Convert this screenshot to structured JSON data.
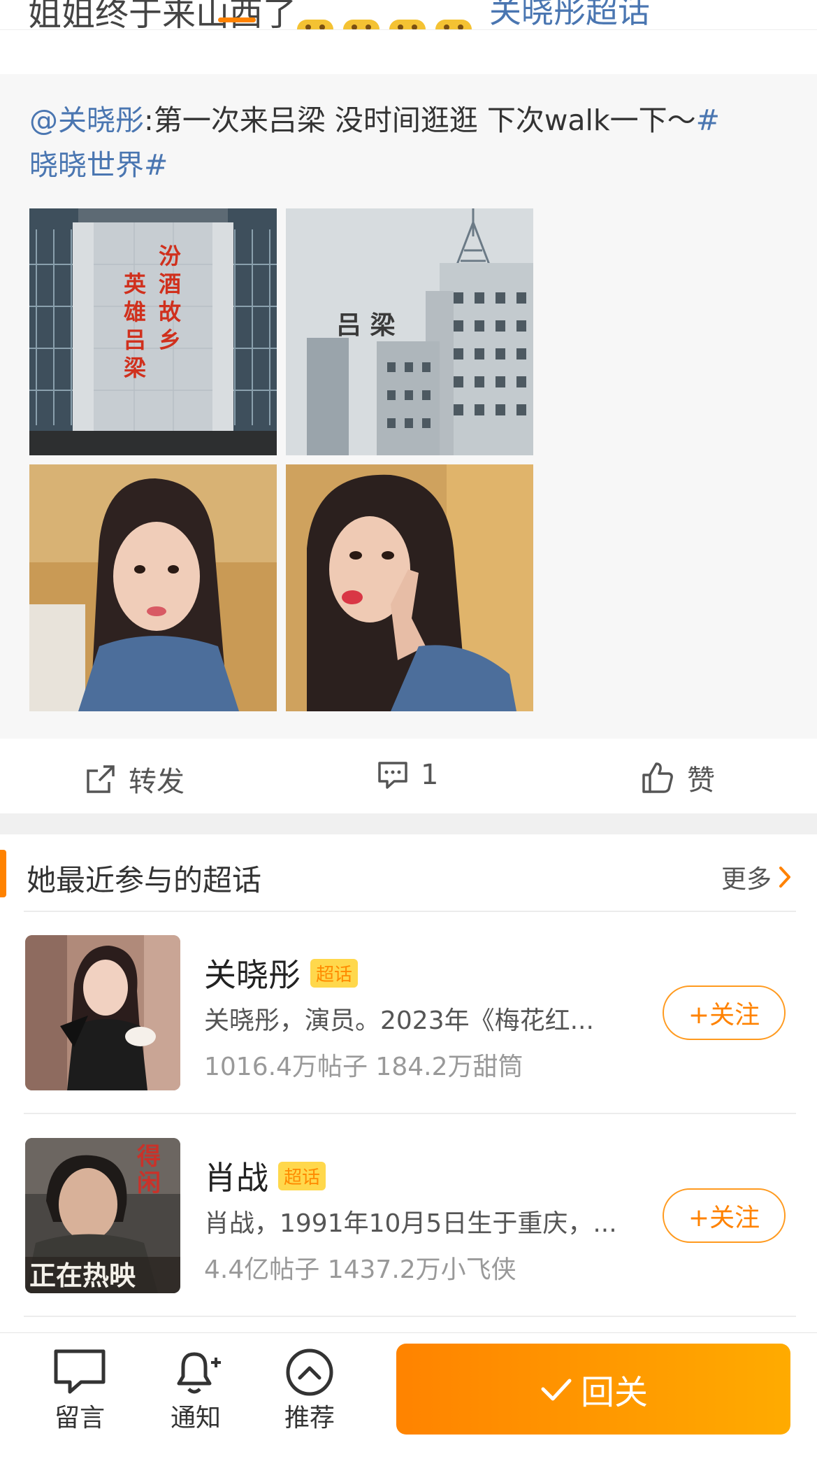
{
  "header": {
    "clipped_text": "姐姐终于来山西了",
    "clipped_link": "关晓彤超话"
  },
  "retweet": {
    "mention": "@关晓彤",
    "text_part1": ":第一次来吕梁 没时间逛逛 下次walk一下～",
    "hashtag_start": "#",
    "hashtag": "晓晓世界#",
    "photos": [
      "photo-building-slogan",
      "photo-lvliang-tower",
      "photo-selfie-1",
      "photo-selfie-2"
    ],
    "photo_texts": {
      "slogan_right": "汾酒故乡",
      "slogan_left": "英雄吕梁",
      "sign": "吕 梁"
    }
  },
  "actions": {
    "repost_label": "转发",
    "comment_count": "1",
    "like_label": "赞"
  },
  "section": {
    "title": "她最近参与的超话",
    "more_label": "更多"
  },
  "topics": [
    {
      "name": "关晓彤",
      "badge": "超话",
      "desc": "关晓彤，演员。2023年《梅花红...",
      "stats": "1016.4万帖子 184.2万甜筒",
      "follow": "+关注"
    },
    {
      "name": "肖战",
      "badge": "超话",
      "desc": "肖战，1991年10月5日生于重庆，...",
      "stats": "4.4亿帖子 1437.2万小飞侠",
      "follow": "+关注",
      "poster_text_top": "得闲",
      "poster_text_bottom": "正在热映"
    }
  ],
  "bottom_bar": {
    "message_label": "留言",
    "notify_label": "通知",
    "recommend_label": "推荐",
    "follow_back_label": "回关"
  },
  "colors": {
    "accent": "#ff8200",
    "link": "#4a76b1"
  }
}
